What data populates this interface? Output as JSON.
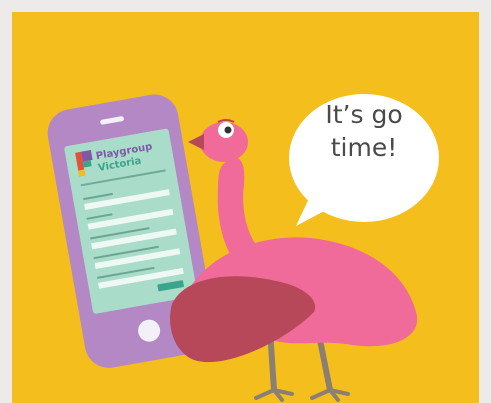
{
  "speech_bubble": {
    "line1": "It’s go",
    "line2": "time!"
  },
  "phone": {
    "brand_line1": "Playgroup",
    "brand_line2": "Victoria"
  },
  "colors": {
    "background": "#f4be1c",
    "frame": "#ecebea",
    "phone_body": "#b488c4",
    "phone_screen": "#a9dcc9",
    "emu_body": "#f06a9a",
    "emu_wing": "#b7485a",
    "emu_legs": "#8b7f73",
    "bubble": "#ffffff"
  },
  "icons": [
    "playgroup-logo-icon",
    "home-button-icon",
    "speaker-icon",
    "emu-illustration",
    "speech-bubble"
  ]
}
